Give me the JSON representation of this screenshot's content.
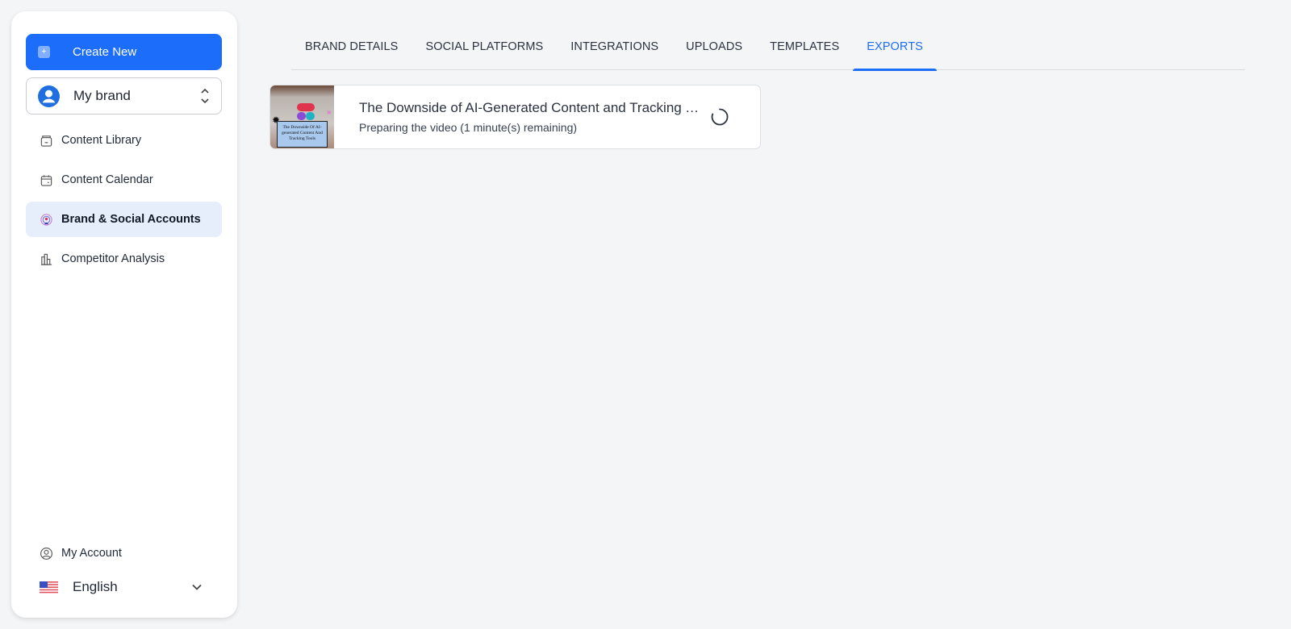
{
  "sidebar": {
    "create_button": {
      "label": "Create New",
      "icon": "plus-icon"
    },
    "brand_selector": {
      "value": "My brand",
      "icon": "user-avatar-icon"
    },
    "nav_items": [
      {
        "label": "Content Library",
        "icon": "archive-icon",
        "active": false
      },
      {
        "label": "Content Calendar",
        "icon": "calendar-icon",
        "active": false
      },
      {
        "label": "Brand & Social Accounts",
        "icon": "broadcast-icon",
        "active": true
      },
      {
        "label": "Competitor Analysis",
        "icon": "bar-chart-icon",
        "active": false
      }
    ],
    "account": {
      "label": "My Account",
      "icon": "user-circle-icon"
    },
    "language": {
      "value": "English",
      "icon": "us-flag-icon"
    }
  },
  "tabs": [
    {
      "label": "BRAND DETAILS",
      "active": false
    },
    {
      "label": "SOCIAL PLATFORMS",
      "active": false
    },
    {
      "label": "INTEGRATIONS",
      "active": false
    },
    {
      "label": "UPLOADS",
      "active": false
    },
    {
      "label": "TEMPLATES",
      "active": false
    },
    {
      "label": "EXPORTS",
      "active": true
    }
  ],
  "exports": [
    {
      "title": "The Downside of AI-Generated Content and Tracking Tools",
      "status": "Preparing the video (1 minute(s) remaining)",
      "thumbnail_caption": "The Downside Of AI-generated Content And Tracking Tools"
    }
  ],
  "colors": {
    "accent": "#1c6dfa",
    "active_nav_bg": "#e6eefc",
    "page_bg": "#f4f5f7"
  }
}
